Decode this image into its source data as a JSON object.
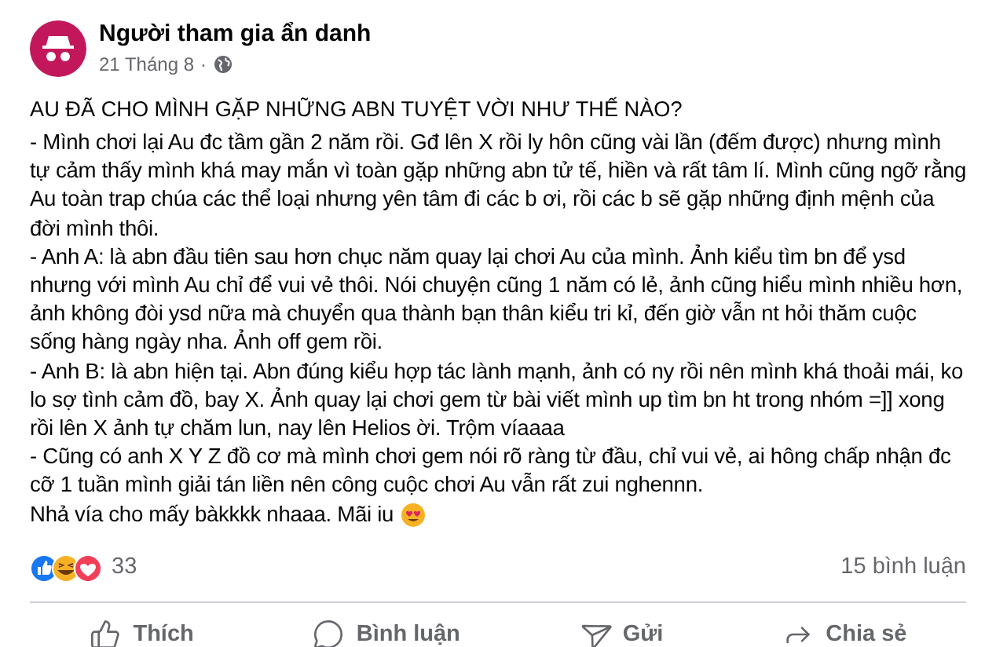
{
  "post": {
    "author": "Người tham gia ẩn danh",
    "date": "21 Tháng 8",
    "separator": "·",
    "title": "AU ĐÃ CHO MÌNH GẶP NHỮNG ABN TUYỆT VỜI NHƯ THẾ NÀO?",
    "paragraphs": [
      "- Mình chơi lại Au đc tầm gần 2 năm rồi. Gđ lên X rồi ly hôn cũng vài lần (đếm được) nhưng mình tự cảm thấy mình khá may mắn vì toàn gặp những abn tử tế, hiền và rất tâm lí. Mình cũng ngỡ rằng Au toàn trap chúa các thể loại nhưng yên tâm đi các b ơi, rồi các b sẽ gặp những định mệnh của đời mình thôi.",
      "- Anh A: là abn đầu tiên sau hơn chục năm quay lại chơi Au của mình. Ảnh kiểu tìm bn để ysd nhưng với mình Au chỉ để vui vẻ thôi. Nói chuyện cũng 1 năm có lẻ, ảnh cũng hiểu mình nhiều hơn, ảnh không đòi ysd nữa mà chuyển qua thành bạn thân kiểu tri kỉ, đến giờ vẫn nt hỏi thăm cuộc sống hàng ngày nha. Ảnh off gem rồi.",
      "- Anh B: là abn hiện tại. Abn đúng kiểu hợp tác lành mạnh, ảnh có ny rồi nên mình khá thoải mái, ko lo sợ tình cảm đồ, bay X. Ảnh quay lại chơi gem từ bài viết mình up tìm bn ht trong nhóm =]] xong rồi lên X ảnh tự chăm lun, nay lên Helios ời. Trộm víaaaa",
      "- Cũng có anh X Y Z đồ cơ mà mình chơi gem nói rõ ràng từ đầu, chỉ vui vẻ, ai hông chấp nhận đc cỡ 1 tuần mình giải tán liền nên công cuộc chơi Au vẫn rất zui nghennn.",
      "Nhả vía cho mấy bàkkkk nhaaa. Mãi iu"
    ],
    "reaction_count": "33",
    "comment_count": "15 bình luận"
  },
  "actions": [
    {
      "kind": "like",
      "label": "Thích"
    },
    {
      "kind": "comment",
      "label": "Bình luận"
    },
    {
      "kind": "send",
      "label": "Gửi"
    },
    {
      "kind": "share",
      "label": "Chia sẻ"
    }
  ]
}
